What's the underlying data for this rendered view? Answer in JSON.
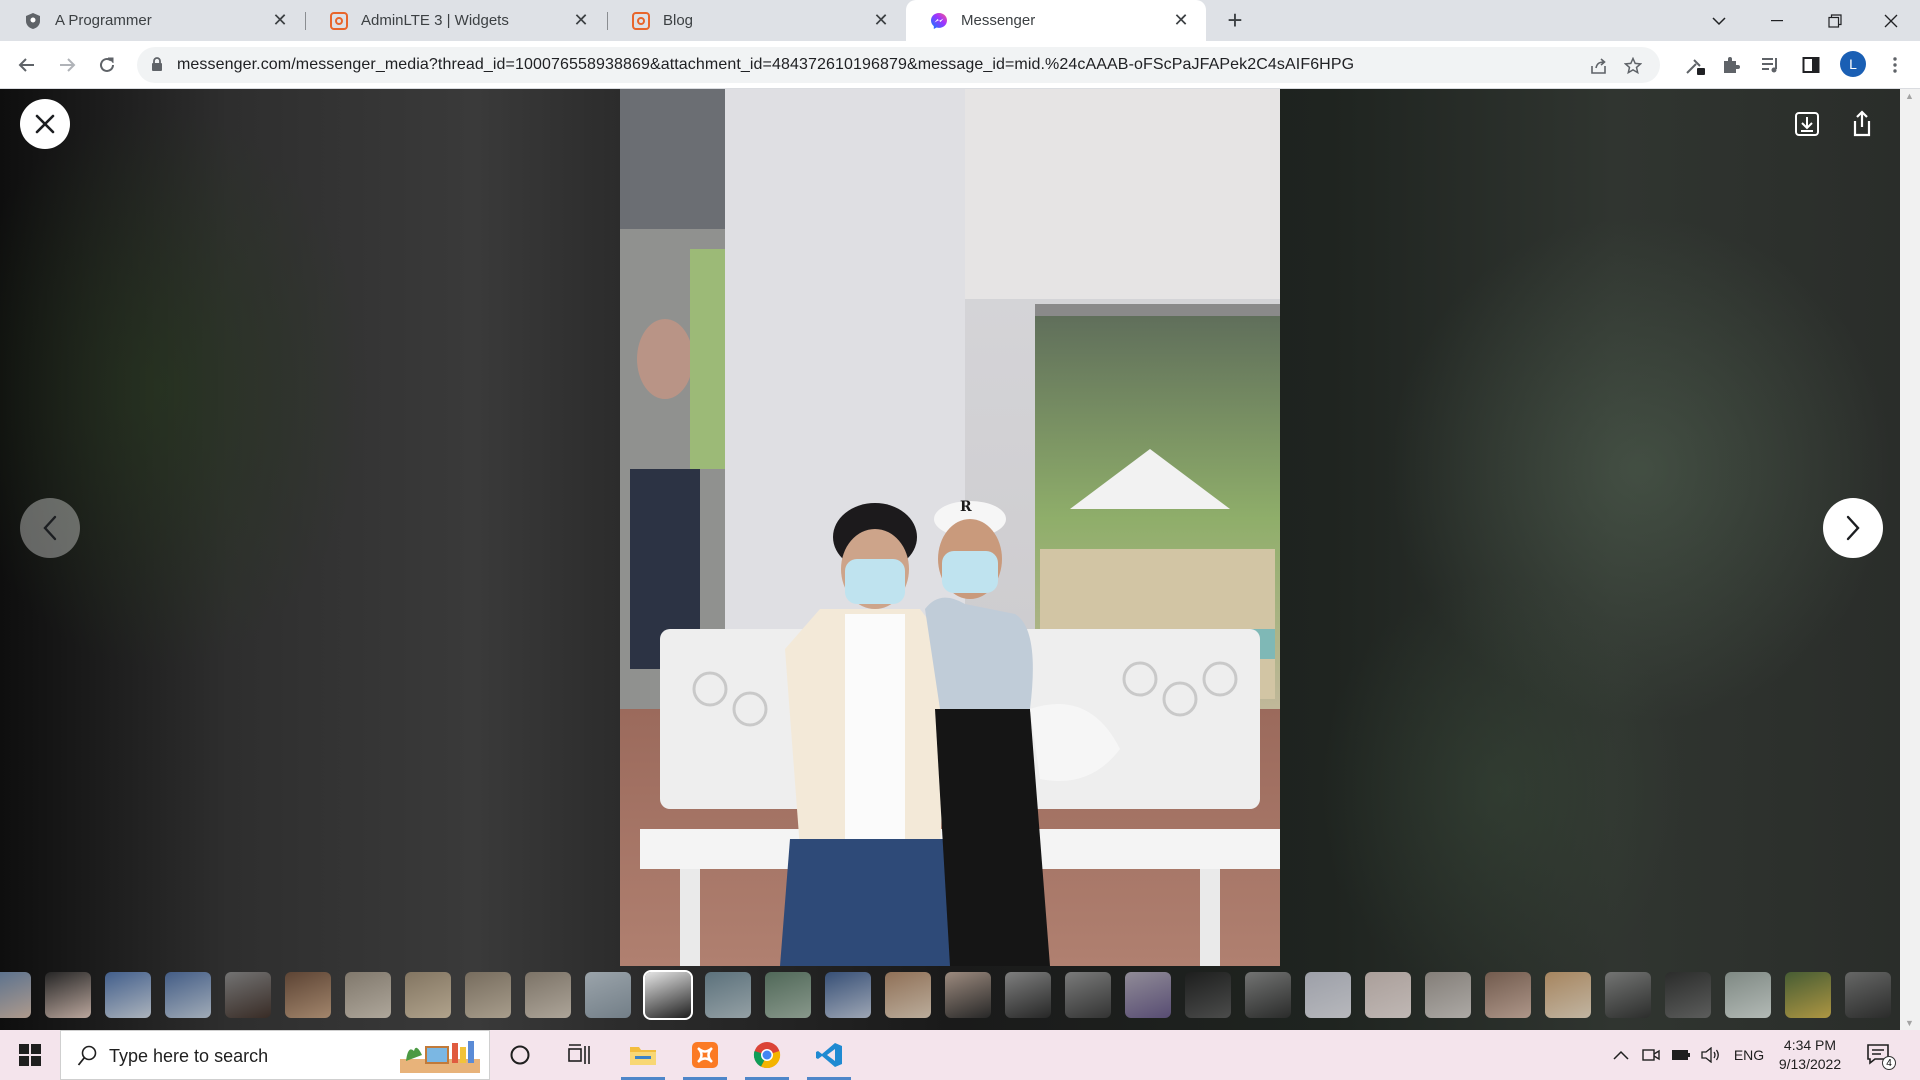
{
  "browser": {
    "tabs": [
      {
        "title": "A Programmer",
        "favicon": "shield-icon",
        "active": false
      },
      {
        "title": "AdminLTE 3 | Widgets",
        "favicon": "adminlte-icon",
        "active": false
      },
      {
        "title": "Blog",
        "favicon": "adminlte-icon",
        "active": false
      },
      {
        "title": "Messenger",
        "favicon": "messenger-icon",
        "active": true
      }
    ],
    "url": "messenger.com/messenger_media?thread_id=100076558938869&attachment_id=484372610196879&message_id=mid.%24cAAAB-oFScPaJFAPek2C4sAIF6HPG",
    "profile_initial": "L"
  },
  "viewer": {
    "photo_caption_letter": "R",
    "thumbnail_count": 32,
    "selected_thumbnail": 11
  },
  "taskbar": {
    "search_placeholder": "Type here to search",
    "language": "ENG",
    "time": "4:34 PM",
    "date": "9/13/2022",
    "notification_count": "4"
  },
  "colors": {
    "accent_blue": "#1a73e8",
    "adminlte_orange": "#e8652b",
    "messenger_gradient": "#a033ff"
  }
}
